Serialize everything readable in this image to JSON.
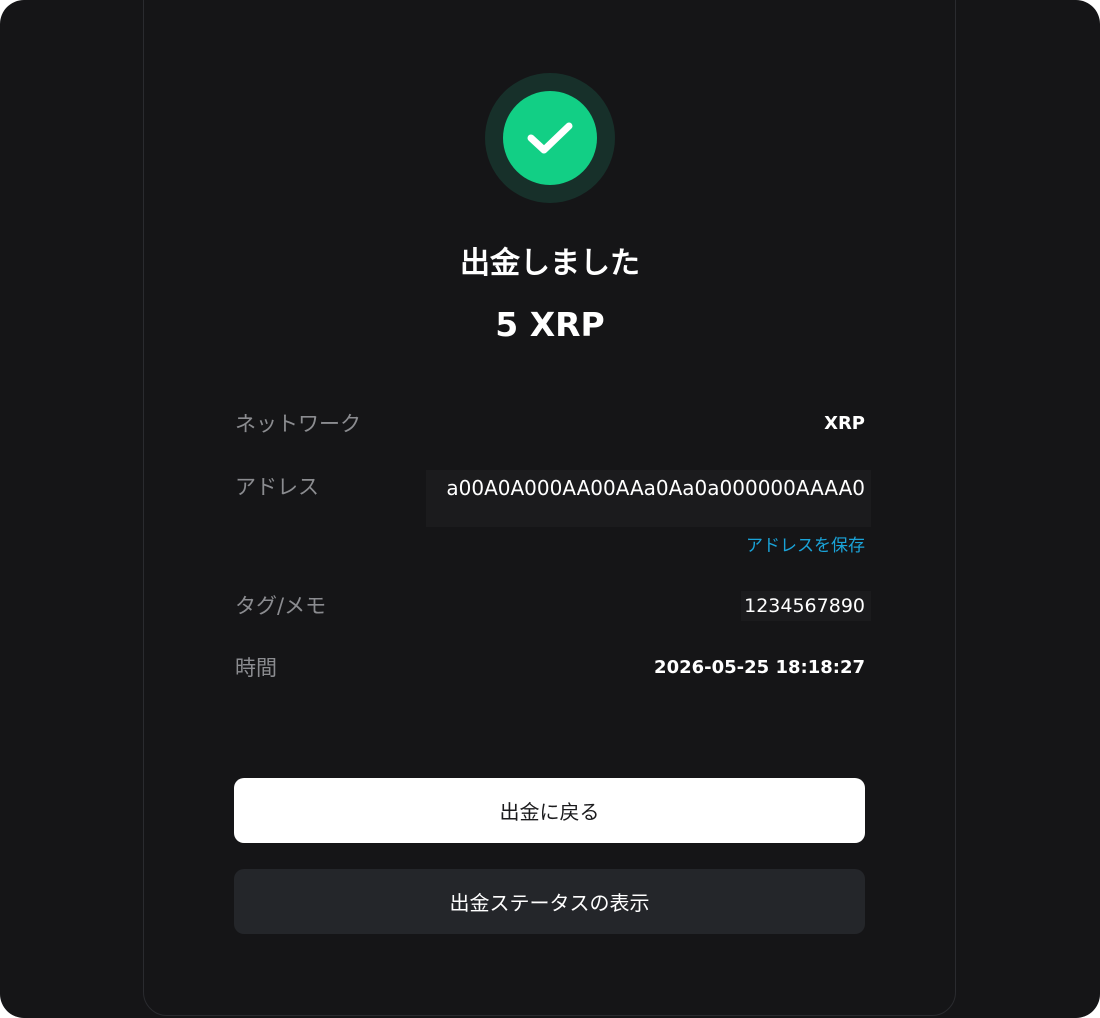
{
  "result": {
    "title": "出金しました",
    "amount": "5 XRP",
    "status_icon": "check-icon",
    "accent_color": "#12cf85"
  },
  "details": {
    "network": {
      "label": "ネットワーク",
      "value": "XRP"
    },
    "address": {
      "label": "アドレス",
      "value": "a00A0A000AA00AAa0Aa0a000000AAAA0",
      "save_link": "アドレスを保存"
    },
    "tag": {
      "label": "タグ/メモ",
      "value": "1234567890"
    },
    "time": {
      "label": "時間",
      "value": "2026-05-25 18:18:27"
    }
  },
  "actions": {
    "back_label": "出金に戻る",
    "status_label": "出金ステータスの表示"
  }
}
